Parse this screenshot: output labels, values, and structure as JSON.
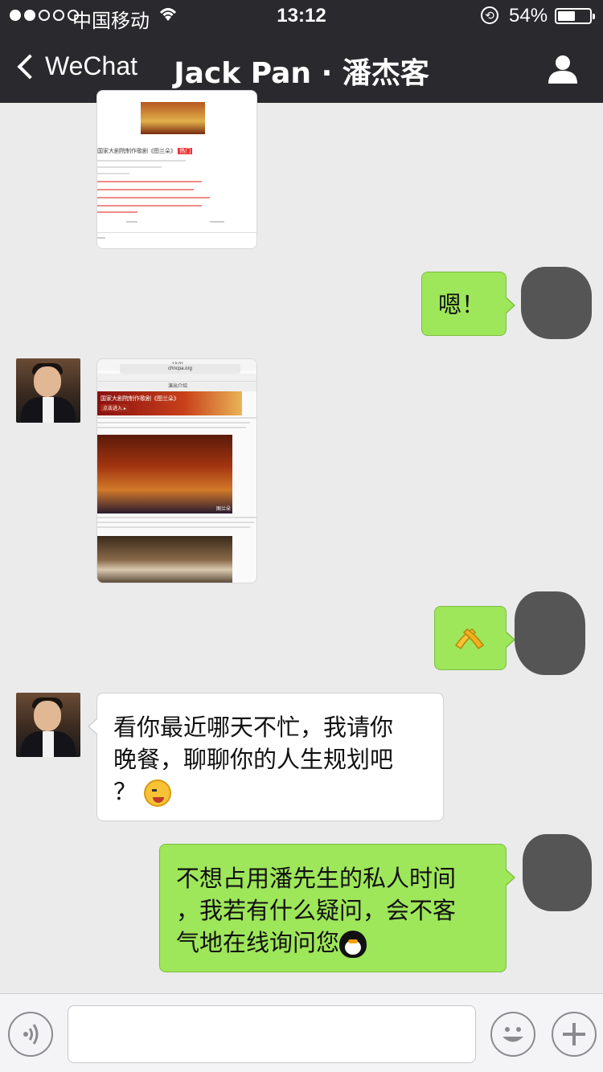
{
  "status_bar": {
    "carrier": "●●○○○ 中国移动",
    "time": "13:12",
    "battery_percent_text": "54%",
    "battery_level": 0.54
  },
  "nav": {
    "back_label": "WeChat",
    "title": "Jack Pan · 潘杰客"
  },
  "messages": [
    {
      "from": "contact",
      "type": "image",
      "content": "webpage-screenshot"
    },
    {
      "from": "me",
      "type": "text",
      "text": "嗯！"
    },
    {
      "from": "contact",
      "type": "image",
      "content": "chncpa.org-screenshot"
    },
    {
      "from": "me",
      "type": "sticker",
      "content": "clap-sticker"
    },
    {
      "from": "contact",
      "type": "text",
      "lines": [
        "看你最近哪天不忙，我请你",
        "晚餐，聊聊你的人生规划吧",
        "？ "
      ],
      "emoji": "wink-emoji"
    },
    {
      "from": "me",
      "type": "text",
      "lines": [
        "不想占用潘先生的私人时间",
        "，我若有什么疑问，会不客",
        "气地在线询问您"
      ],
      "emoji": "qq-penguin-emoji"
    }
  ],
  "shots": {
    "top": {
      "headline": "国家大剧院制作歌剧《图兰朵》",
      "tag": "热门"
    },
    "mid": {
      "time": "13:01",
      "url": "chncpa.org",
      "section": "演出介绍",
      "banner_title": "国家大剧院制作歌剧《图兰朵》",
      "banner_btn": "点击进入 ▸",
      "caption": "图兰朵"
    }
  },
  "colors": {
    "topbar": "#2a2a2e",
    "chat_bg": "#ebebeb",
    "bubble_green": "#9ee65a",
    "bubble_white": "#ffffff"
  }
}
